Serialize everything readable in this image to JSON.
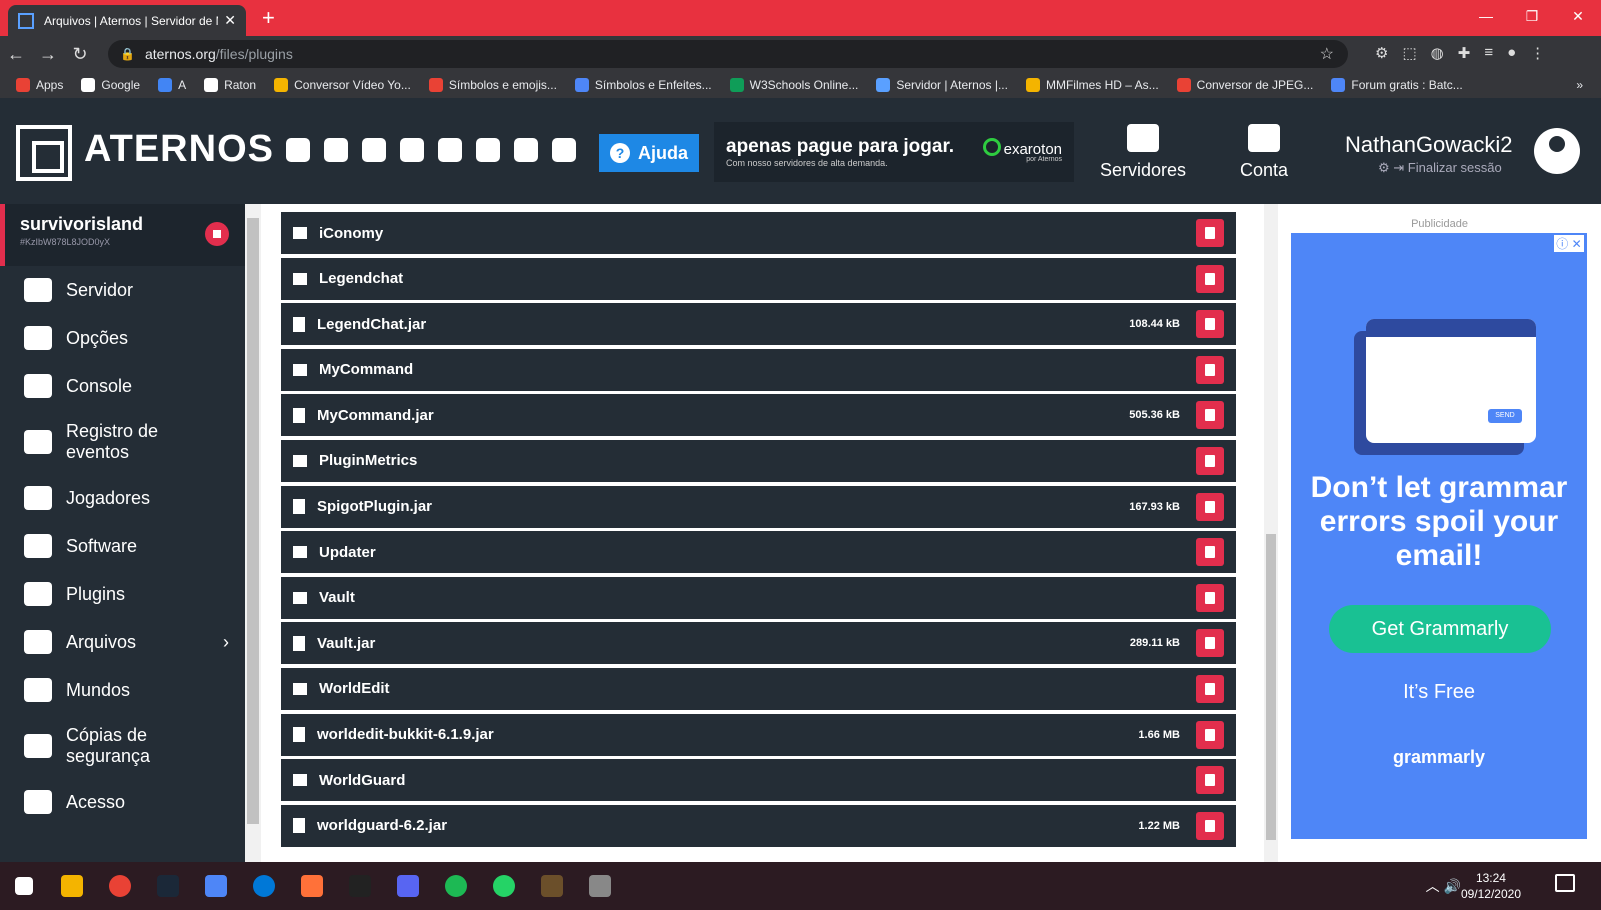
{
  "browser": {
    "tab_title": "Arquivos | Aternos | Servidor de M",
    "url_host": "aternos.org",
    "url_path": "/files/plugins",
    "bookmarks": [
      {
        "label": "Apps",
        "color": "#e94235"
      },
      {
        "label": "Google",
        "color": "#ffffff"
      },
      {
        "label": "A",
        "color": "#4285f4"
      },
      {
        "label": "Raton",
        "color": "#ffffff"
      },
      {
        "label": "Conversor Vídeo Yo...",
        "color": "#f4b400"
      },
      {
        "label": "Símbolos e emojis...",
        "color": "#e94235"
      },
      {
        "label": "Símbolos e Enfeites...",
        "color": "#4e86f7"
      },
      {
        "label": "W3Schools Online...",
        "color": "#0f9d58"
      },
      {
        "label": "Servidor | Aternos |...",
        "color": "#5aa0ff"
      },
      {
        "label": "MMFilmes HD – As...",
        "color": "#f4b400"
      },
      {
        "label": "Conversor de JPEG...",
        "color": "#e94235"
      },
      {
        "label": "Forum gratis : Batc...",
        "color": "#4e86f7"
      }
    ]
  },
  "header": {
    "brand": "ATERNOS",
    "help_label": "Ajuda",
    "promo_title": "apenas pague para jogar.",
    "promo_sub": "Com nosso servidores de alta demanda.",
    "promo_brand": "exaroton",
    "promo_brand_sub": "por Aternos",
    "nav_servers": "Servidores",
    "nav_account": "Conta",
    "username": "NathanGowacki2",
    "logout": "Finalizar sessão"
  },
  "sidebar": {
    "server_name": "survivorisland",
    "server_id": "#KzIbW878L8JOD0yX",
    "items": [
      {
        "label": "Servidor",
        "icon": "power-icon"
      },
      {
        "label": "Opções",
        "icon": "sliders-icon"
      },
      {
        "label": "Console",
        "icon": "terminal-icon"
      },
      {
        "label": "Registro de eventos",
        "icon": "document-icon"
      },
      {
        "label": "Jogadores",
        "icon": "users-icon"
      },
      {
        "label": "Software",
        "icon": "gears-icon"
      },
      {
        "label": "Plugins",
        "icon": "puzzle-icon"
      },
      {
        "label": "Arquivos",
        "icon": "folder-icon"
      },
      {
        "label": "Mundos",
        "icon": "globe-icon"
      },
      {
        "label": "Cópias de segurança",
        "icon": "history-icon"
      },
      {
        "label": "Acesso",
        "icon": "user-lock-icon"
      }
    ]
  },
  "files": [
    {
      "name": "iConomy",
      "type": "folder",
      "size": ""
    },
    {
      "name": "Legendchat",
      "type": "folder",
      "size": ""
    },
    {
      "name": "LegendChat.jar",
      "type": "file",
      "size": "108.44 kB"
    },
    {
      "name": "MyCommand",
      "type": "folder",
      "size": ""
    },
    {
      "name": "MyCommand.jar",
      "type": "file",
      "size": "505.36 kB"
    },
    {
      "name": "PluginMetrics",
      "type": "folder",
      "size": ""
    },
    {
      "name": "SpigotPlugin.jar",
      "type": "file",
      "size": "167.93 kB"
    },
    {
      "name": "Updater",
      "type": "folder",
      "size": ""
    },
    {
      "name": "Vault",
      "type": "folder",
      "size": ""
    },
    {
      "name": "Vault.jar",
      "type": "file",
      "size": "289.11 kB"
    },
    {
      "name": "WorldEdit",
      "type": "folder",
      "size": ""
    },
    {
      "name": "worldedit-bukkit-6.1.9.jar",
      "type": "file",
      "size": "1.66 MB"
    },
    {
      "name": "WorldGuard",
      "type": "folder",
      "size": ""
    },
    {
      "name": "worldguard-6.2.jar",
      "type": "file",
      "size": "1.22 MB"
    }
  ],
  "ad": {
    "label": "Publicidade",
    "send": "SEND",
    "headline": "Don’t let grammar errors spoil your email!",
    "cta": "Get Grammarly",
    "sub": "It’s Free",
    "brand": "grammarly"
  },
  "taskbar": {
    "time": "13:24",
    "date": "09/12/2020",
    "apps": [
      "#f4b400",
      "#e94235",
      "#1b2838",
      "#4e86f7",
      "#0078d7",
      "#ff7139",
      "#222222",
      "#5865f2",
      "#1db954",
      "#25d366",
      "#6b4f2a",
      "#888888"
    ]
  },
  "colors": {
    "accent": "#e22e4d",
    "panel": "#242d36",
    "help": "#1e88e5"
  }
}
